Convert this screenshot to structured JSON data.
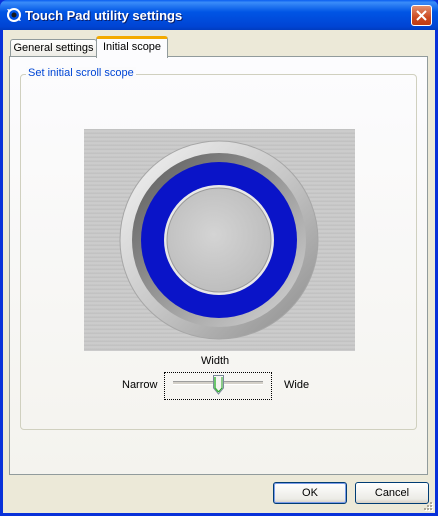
{
  "window": {
    "title": "Touch Pad utility settings",
    "title_icon": "touchpad-utility-icon",
    "close_icon": "close-icon"
  },
  "tabs": [
    {
      "label": "General settings",
      "active": false
    },
    {
      "label": "Initial scope",
      "active": true
    }
  ],
  "group": {
    "label": "Set initial scroll scope"
  },
  "preview": {
    "ring_color": "#0a14c8",
    "center_color": "#c8c8c8",
    "background_color": "#c6c6c6"
  },
  "slider": {
    "title": "Width",
    "min_label": "Narrow",
    "max_label": "Wide",
    "position_fraction": 0.5
  },
  "buttons": {
    "ok": "OK",
    "cancel": "Cancel"
  },
  "colors": {
    "titlebar": "#0055e5",
    "accent_tab": "#f3a900",
    "group_label": "#0046d5",
    "dialog_bg": "#ece9d8"
  }
}
